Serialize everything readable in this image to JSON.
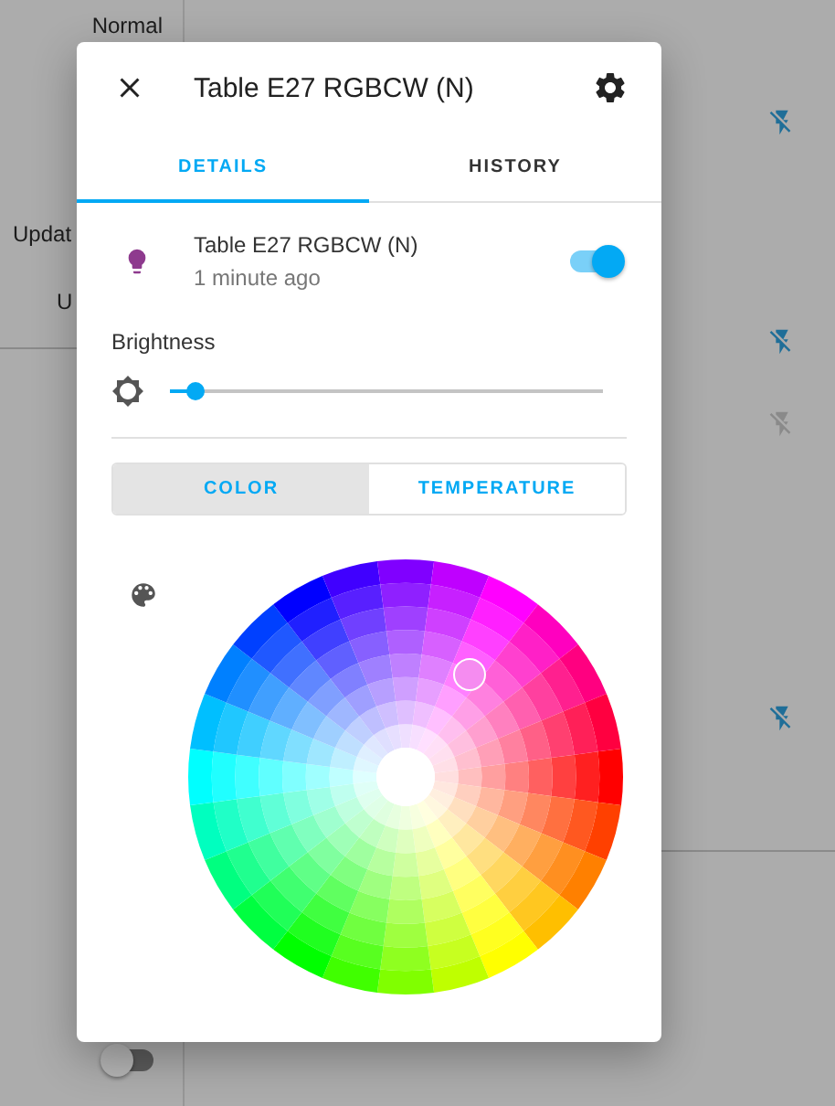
{
  "background": {
    "labels": [
      "Normal",
      "Updat",
      "U"
    ],
    "toggle": {
      "on": false
    },
    "icons": [
      {
        "disabled": false
      },
      {
        "disabled": false
      },
      {
        "disabled": true
      },
      {
        "disabled": false
      }
    ]
  },
  "dialog": {
    "title": "Table E27 RGBCW (N)",
    "tabs": [
      {
        "label": "DETAILS",
        "selected": true
      },
      {
        "label": "HISTORY",
        "selected": false
      }
    ],
    "entity": {
      "name": "Table E27 RGBCW (N)",
      "updated": "1 minute ago",
      "on": true
    },
    "brightness": {
      "label": "Brightness",
      "level": 0.06
    },
    "modes": [
      {
        "label": "COLOR",
        "selected": true
      },
      {
        "label": "TEMPERATURE",
        "selected": false
      }
    ]
  }
}
